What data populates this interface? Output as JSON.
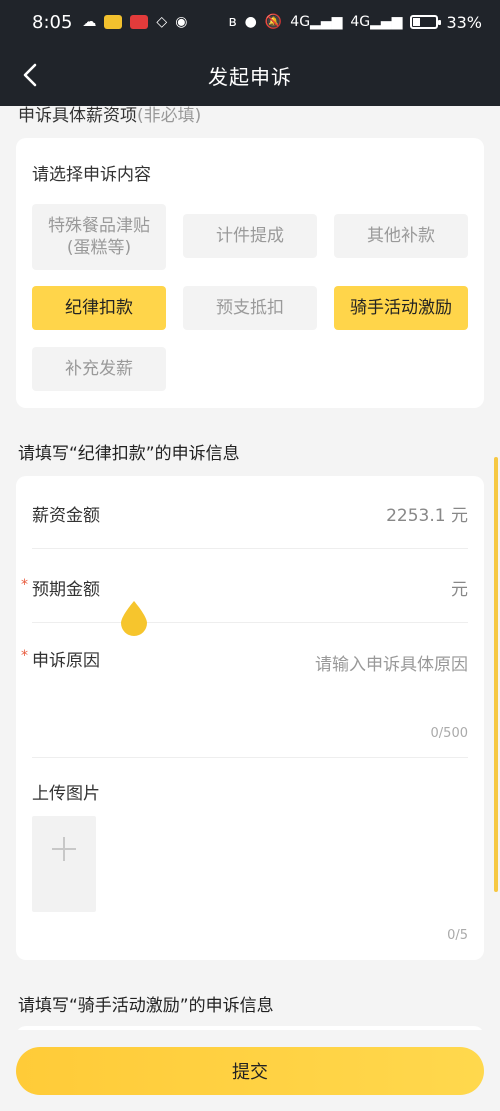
{
  "status_bar": {
    "time": "8:05",
    "battery_text": "33%",
    "battery_level": 0.33,
    "icons": [
      "weather-icon",
      "app-icon",
      "app-icon-2",
      "app-icon-3",
      "eye-icon",
      "bluetooth-icon",
      "location-icon",
      "mute-icon",
      "signal-icon",
      "signal-icon-2"
    ],
    "signal_labels": [
      "4G",
      "4G"
    ]
  },
  "header": {
    "title": "发起申诉",
    "back_icon": "chevron-left-icon"
  },
  "top_section": {
    "title_text": "申诉具体薪资项",
    "title_suffix": "(非必填)"
  },
  "choose_card": {
    "heading": "请选择申诉内容",
    "options": [
      {
        "label": "特殊餐品津贴\n(蛋糕等)",
        "active": false
      },
      {
        "label": "计件提成",
        "active": false
      },
      {
        "label": "其他补款",
        "active": false
      },
      {
        "label": "纪律扣款",
        "active": true
      },
      {
        "label": "预支抵扣",
        "active": false
      },
      {
        "label": "骑手活动激励",
        "active": true
      },
      {
        "label": "补充发薪",
        "active": false
      }
    ]
  },
  "form_section": {
    "title": "请填写“纪律扣款”的申诉信息",
    "salary_label": "薪资金额",
    "salary_value": "2253.1 元",
    "expected_label": "预期金额",
    "expected_unit": "元",
    "reason_label": "申诉原因",
    "reason_placeholder": "请输入申诉具体原因",
    "reason_counter": "0/500",
    "required_mark": "*",
    "upload_label": "上传图片",
    "upload_counter": "0/5",
    "add_icon": "plus-icon"
  },
  "second_section": {
    "title": "请填写“骑手活动激励”的申诉信息"
  },
  "footer": {
    "submit_label": "提交"
  },
  "colors": {
    "header_bg": "#20242a",
    "accent": "#ffd54a",
    "required": "#e85a3d"
  }
}
